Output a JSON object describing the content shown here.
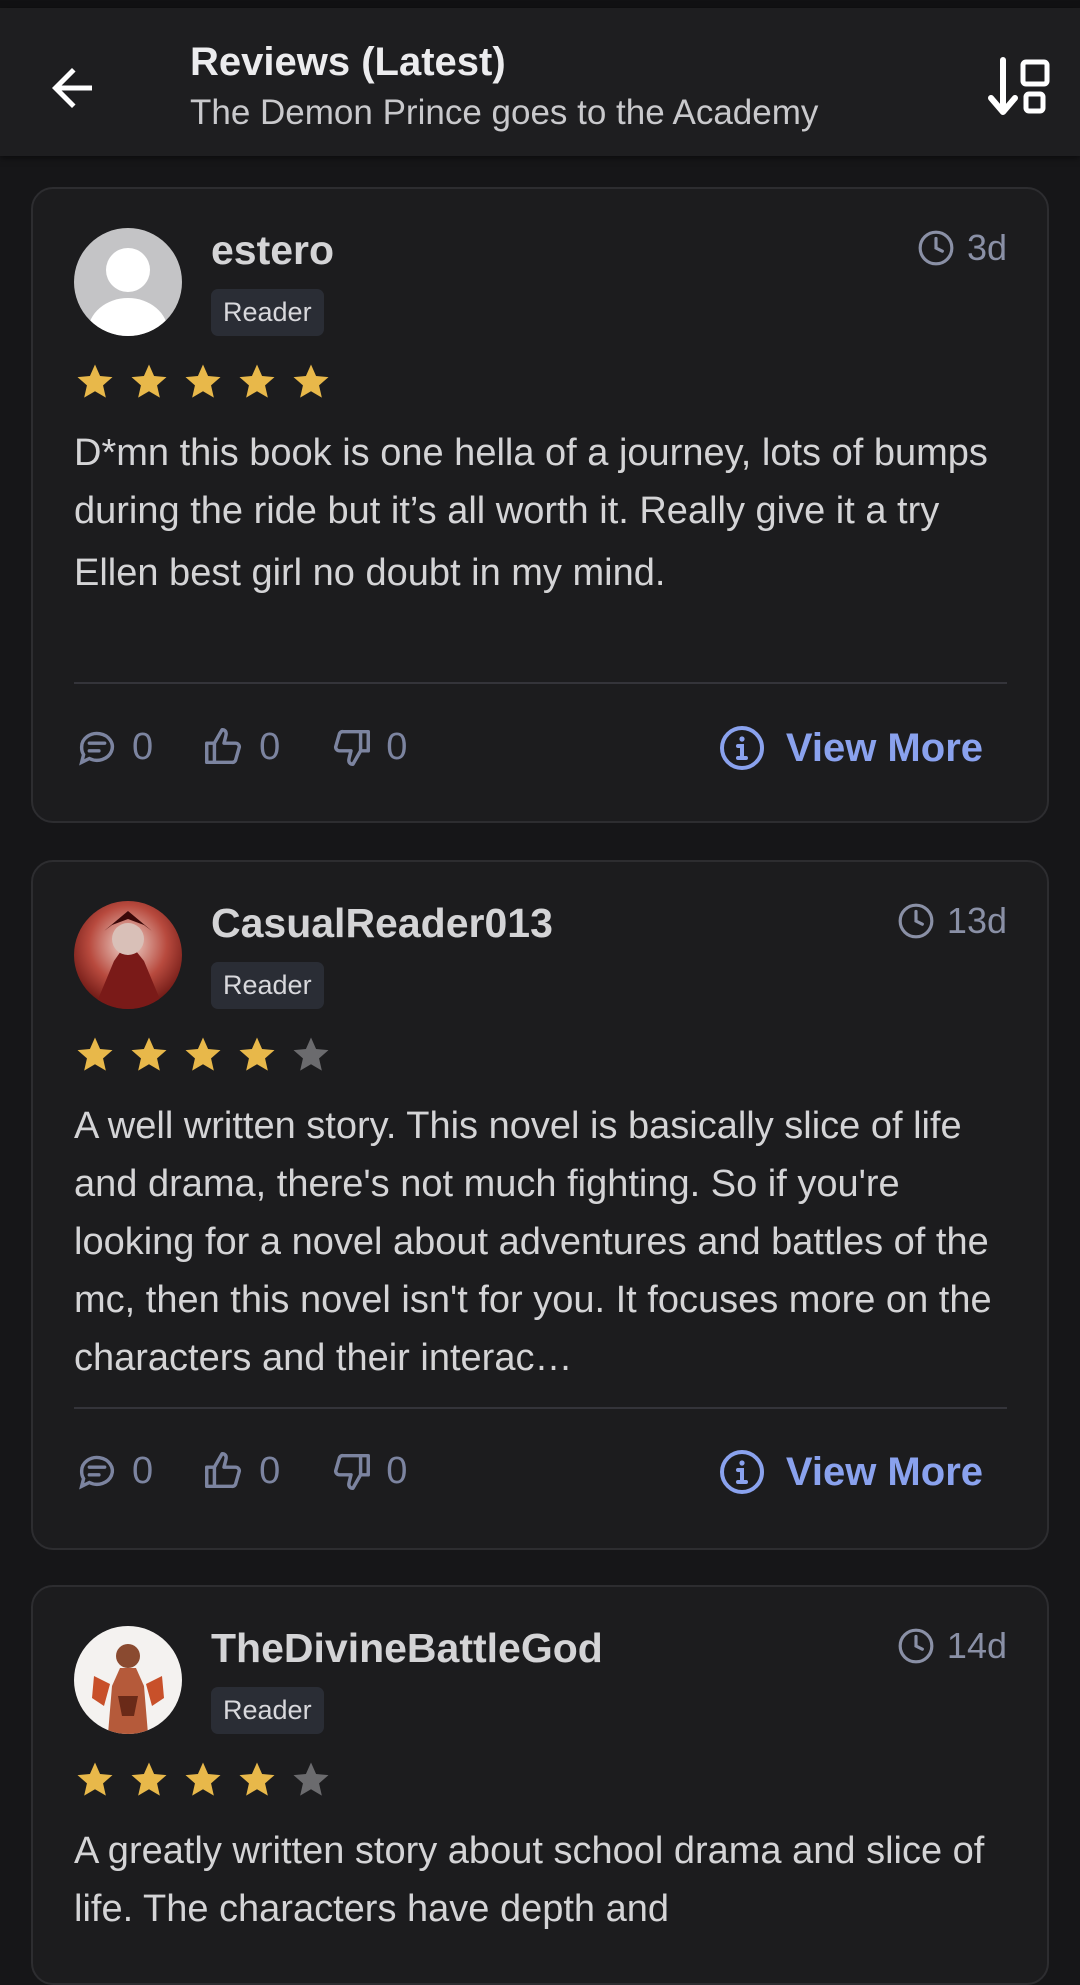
{
  "header": {
    "title": "Reviews (Latest)",
    "subtitle": "The Demon Prince goes to the Academy",
    "back_icon": "arrow-left-icon",
    "sort_icon": "sort-down-icon"
  },
  "colors": {
    "star_filled": "#e8b84a",
    "star_empty": "#6b6b6e",
    "link": "#8aa2ee",
    "muted": "#7c84a0"
  },
  "reviews": [
    {
      "username": "estero",
      "role": "Reader",
      "time": "3d",
      "rating": 5,
      "text_lines": [
        "D*mn this book is one hella of a journey, lots of bumps during the ride but it’s all worth it. Really give it a try",
        "Ellen best girl no doubt in my mind."
      ],
      "comments": "0",
      "likes": "0",
      "dislikes": "0",
      "view_more": "View More"
    },
    {
      "username": "CasualReader013",
      "role": "Reader",
      "time": "13d",
      "rating": 4,
      "text_lines": [
        "A well written story. This novel is basically slice of life and drama, there's not much fighting. So if you're looking for a novel about adventures and battles of the mc, then this novel isn't for you. It focuses more on the characters and their interac…"
      ],
      "comments": "0",
      "likes": "0",
      "dislikes": "0",
      "view_more": "View More"
    },
    {
      "username": "TheDivineBattleGod",
      "role": "Reader",
      "time": "14d",
      "rating": 4,
      "text_lines": [
        "A greatly written story about school drama and slice of life. The characters have depth and"
      ],
      "comments": "",
      "likes": "",
      "dislikes": "",
      "view_more": ""
    }
  ]
}
